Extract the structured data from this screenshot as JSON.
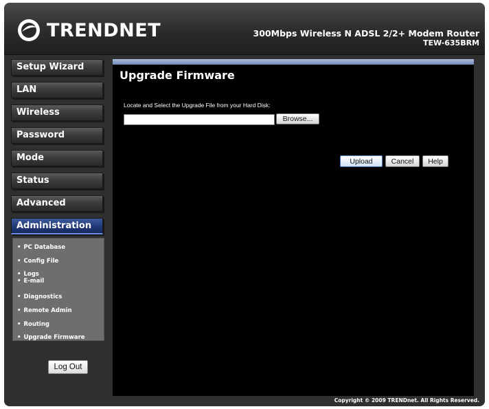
{
  "brand": {
    "logo_text": "TRENDNET",
    "product_name": "300Mbps Wireless N ADSL 2/2+ Modem Router",
    "model": "TEW-635BRM"
  },
  "sidebar": {
    "items": [
      {
        "label": "Setup Wizard"
      },
      {
        "label": "LAN"
      },
      {
        "label": "Wireless"
      },
      {
        "label": "Password"
      },
      {
        "label": "Mode"
      },
      {
        "label": "Status"
      },
      {
        "label": "Advanced"
      },
      {
        "label": "Administration",
        "active": true
      }
    ],
    "submenu": [
      {
        "label": "PC Database"
      },
      {
        "label": "Config File"
      },
      {
        "label": "Logs"
      },
      {
        "label": "E-mail"
      },
      {
        "label": "Diagnostics"
      },
      {
        "label": "Remote Admin"
      },
      {
        "label": "Routing"
      },
      {
        "label": "Upgrade Firmware"
      }
    ],
    "bullet": "•",
    "logout_label": "Log Out"
  },
  "main": {
    "title": "Upgrade Firmware",
    "locate_label": "Locate and Select the Upgrade File from your Hard Disk:",
    "file_value": "",
    "browse_label": "Browse...",
    "upload_label": "Upload",
    "cancel_label": "Cancel",
    "help_label": "Help"
  },
  "footer": {
    "copyright": "Copyright © 2009 TRENDnet. All Rights Reserved."
  },
  "colors": {
    "active_nav": "#203a78",
    "content_bg": "#000000",
    "frame_bg": "#2f2f2f"
  }
}
